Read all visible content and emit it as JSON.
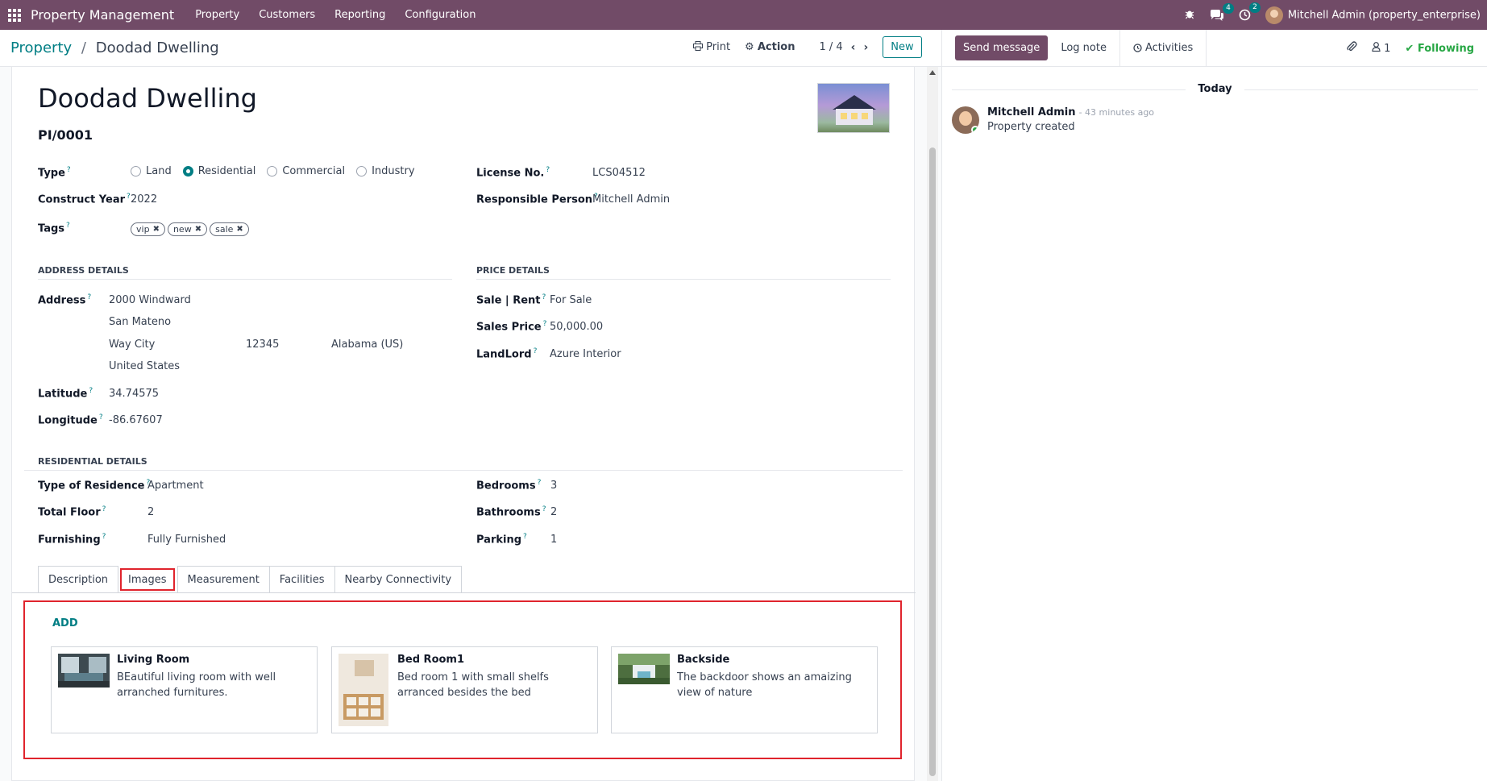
{
  "topbar": {
    "brand": "Property Management",
    "menu": [
      "Property",
      "Customers",
      "Reporting",
      "Configuration"
    ],
    "messages_count": "4",
    "activities_count": "2",
    "user": "Mitchell Admin (property_enterprise)"
  },
  "control": {
    "breadcrumb_root": "Property",
    "breadcrumb_sep": "/",
    "breadcrumb_current": "Doodad Dwelling",
    "print_label": "Print",
    "action_label": "Action",
    "pager": "1 / 4",
    "new_label": "New"
  },
  "form": {
    "name": "Doodad Dwelling",
    "reference": "PI/0001",
    "type_label": "Type",
    "type_options": [
      "Land",
      "Residential",
      "Commercial",
      "Industry"
    ],
    "type_selected": "Residential",
    "construct_year_label": "Construct Year",
    "construct_year": "2022",
    "tags_label": "Tags",
    "tags": [
      "vip",
      "new",
      "sale"
    ],
    "license_label": "License No.",
    "license": "LCS04512",
    "responsible_label": "Responsible Person",
    "responsible": "Mitchell Admin",
    "address_section": "ADDRESS DETAILS",
    "address_label": "Address",
    "street": "2000 Windward",
    "street2": "San Mateno",
    "city": "Way City",
    "zip": "12345",
    "state": "Alabama (US)",
    "country": "United States",
    "latitude_label": "Latitude",
    "latitude": "34.74575",
    "longitude_label": "Longitude",
    "longitude": "-86.67607",
    "price_section": "PRICE DETAILS",
    "sale_rent_label": "Sale | Rent",
    "sale_rent": "For Sale",
    "sales_price_label": "Sales Price",
    "sales_price": "50,000.00",
    "landlord_label": "LandLord",
    "landlord": "Azure Interior",
    "residential_section": "RESIDENTIAL DETAILS",
    "residence_type_label": "Type of Residence",
    "residence_type": "Apartment",
    "total_floor_label": "Total Floor",
    "total_floor": "2",
    "furnishing_label": "Furnishing",
    "furnishing": "Fully Furnished",
    "bedrooms_label": "Bedrooms",
    "bedrooms": "3",
    "bathrooms_label": "Bathrooms",
    "bathrooms": "2",
    "parking_label": "Parking",
    "parking": "1"
  },
  "tabs": [
    "Description",
    "Images",
    "Measurement",
    "Facilities",
    "Nearby Connectivity"
  ],
  "active_tab": "Images",
  "images": {
    "add_label": "ADD",
    "cards": [
      {
        "title": "Living Room",
        "description": "BEautiful living room with well arranched furnitures."
      },
      {
        "title": "Bed Room1",
        "description": "Bed room 1 with small shelfs arranced besides the bed"
      },
      {
        "title": "Backside",
        "description": "The backdoor shows an amaizing view of nature"
      }
    ]
  },
  "chatter": {
    "send_message": "Send message",
    "log_note": "Log note",
    "activities": "Activities",
    "followers_count": "1",
    "following": "Following",
    "day": "Today",
    "message_author": "Mitchell Admin",
    "message_time": "- 43 minutes ago",
    "message_text": "Property created"
  },
  "colors": {
    "brand": "#714b67",
    "accent": "#017e84",
    "highlight": "#e0242d",
    "following": "#28a745"
  }
}
